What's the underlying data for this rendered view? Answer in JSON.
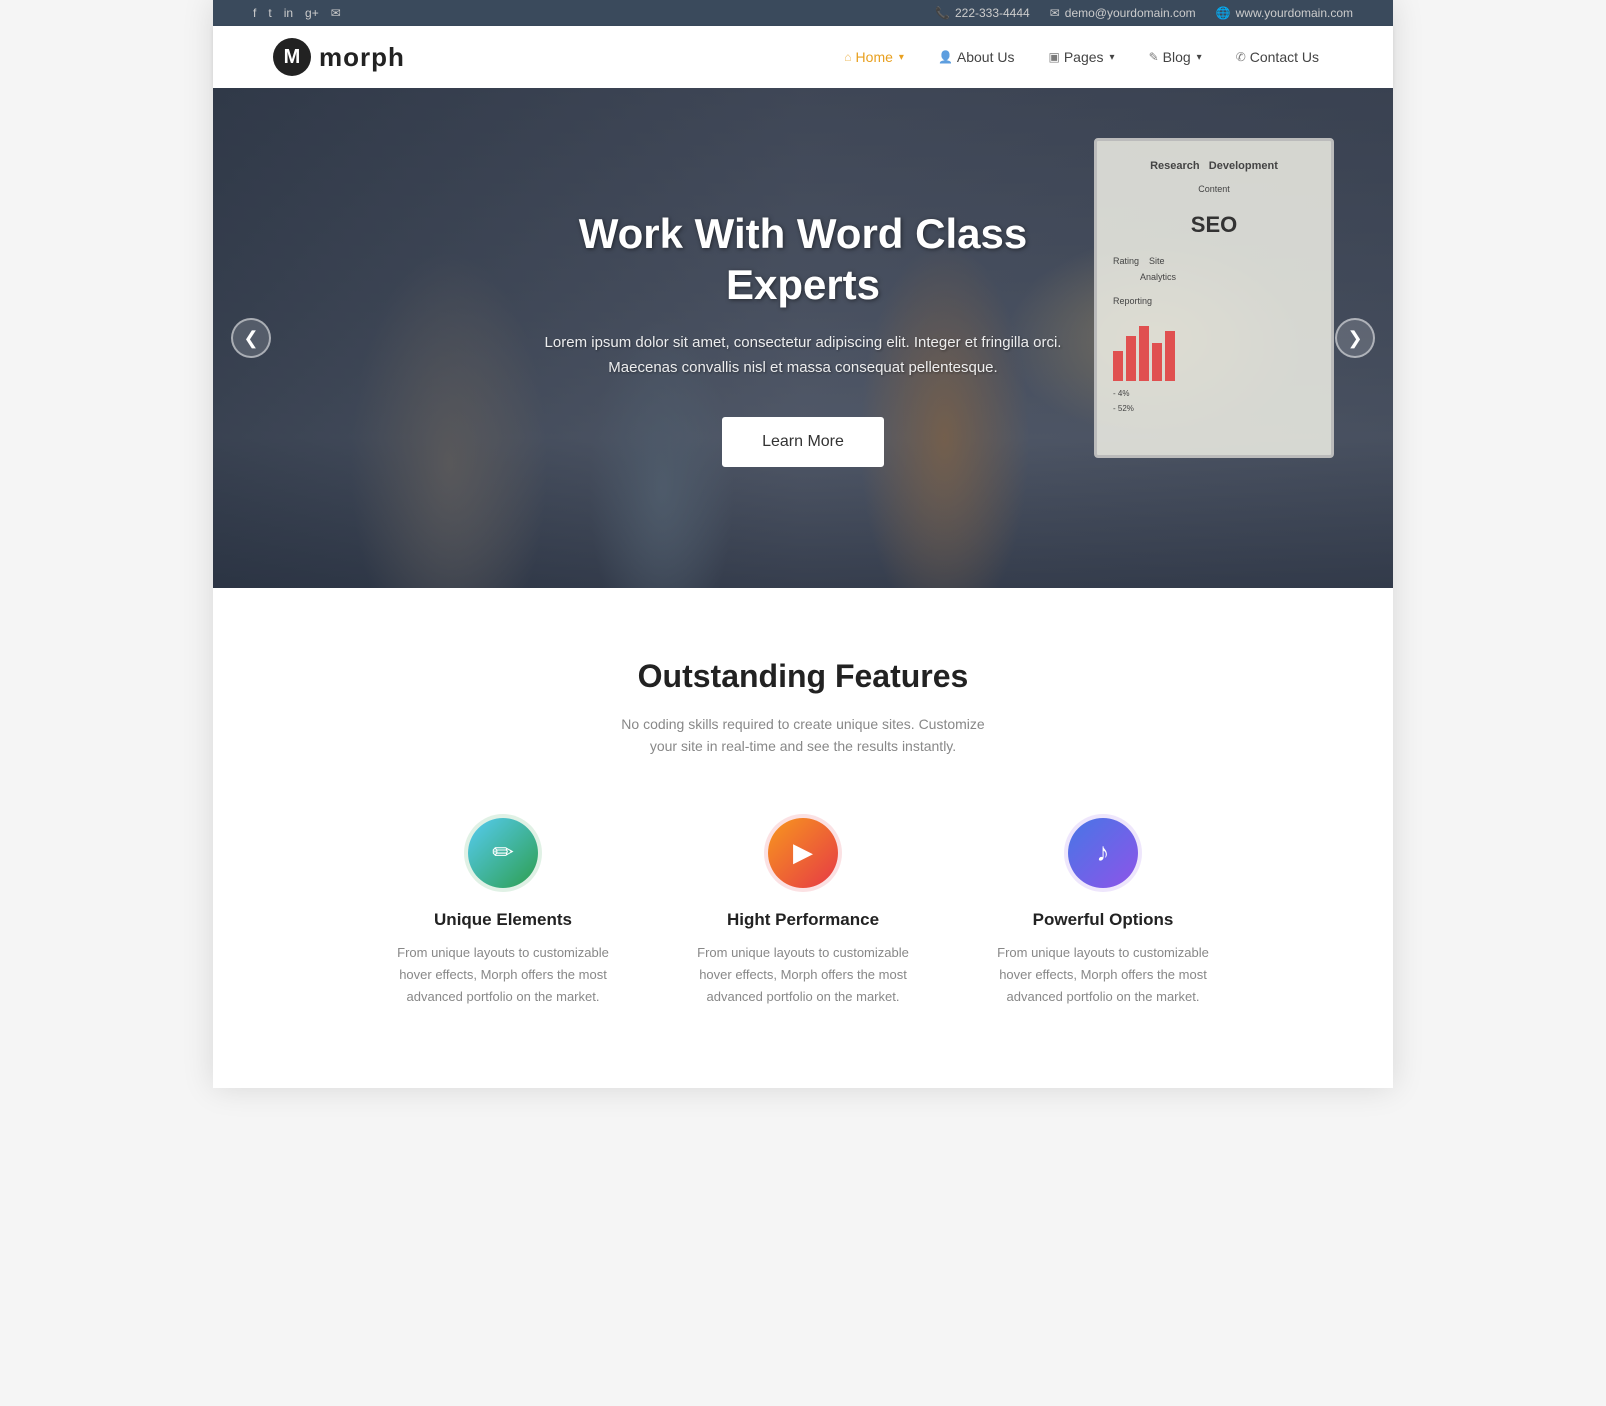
{
  "topbar": {
    "social": [
      "f",
      "t",
      "in",
      "g+",
      "✉"
    ],
    "phone": "222-333-4444",
    "email": "demo@yourdomain.com",
    "website": "www.yourdomain.com"
  },
  "header": {
    "logo_letter": "M",
    "brand_name": "morph",
    "nav": [
      {
        "label": "Home",
        "icon": "⌂",
        "active": true,
        "has_caret": true
      },
      {
        "label": "About Us",
        "icon": "👤",
        "active": false,
        "has_caret": false
      },
      {
        "label": "Pages",
        "icon": "▣",
        "active": false,
        "has_caret": true
      },
      {
        "label": "Blog",
        "icon": "✎",
        "active": false,
        "has_caret": true
      },
      {
        "label": "Contact Us",
        "icon": "✆",
        "active": false,
        "has_caret": false
      }
    ]
  },
  "hero": {
    "title": "Work With Word Class Experts",
    "description": "Lorem ipsum dolor sit amet, consectetur adipiscing elit. Integer et fringilla orci. Maecenas convallis nisl et massa consequat pellentesque.",
    "cta_label": "Learn More",
    "prev_arrow": "❮",
    "next_arrow": "❯"
  },
  "features": {
    "title": "Outstanding Features",
    "subtitle": "No coding skills required to create unique sites. Customize your site in real-time and see the results instantly.",
    "items": [
      {
        "icon": "✏",
        "icon_class": "icon-green",
        "name": "Unique Elements",
        "description": "From unique layouts to customizable hover effects, Morph offers the most advanced portfolio on the market."
      },
      {
        "icon": "▶",
        "icon_class": "icon-orange",
        "name": "Hight Performance",
        "description": "From unique layouts to customizable hover effects, Morph offers the most advanced portfolio on the market."
      },
      {
        "icon": "♪",
        "icon_class": "icon-purple",
        "name": "Powerful Options",
        "description": "From unique layouts to customizable hover effects, Morph offers the most advanced portfolio on the market."
      }
    ]
  }
}
